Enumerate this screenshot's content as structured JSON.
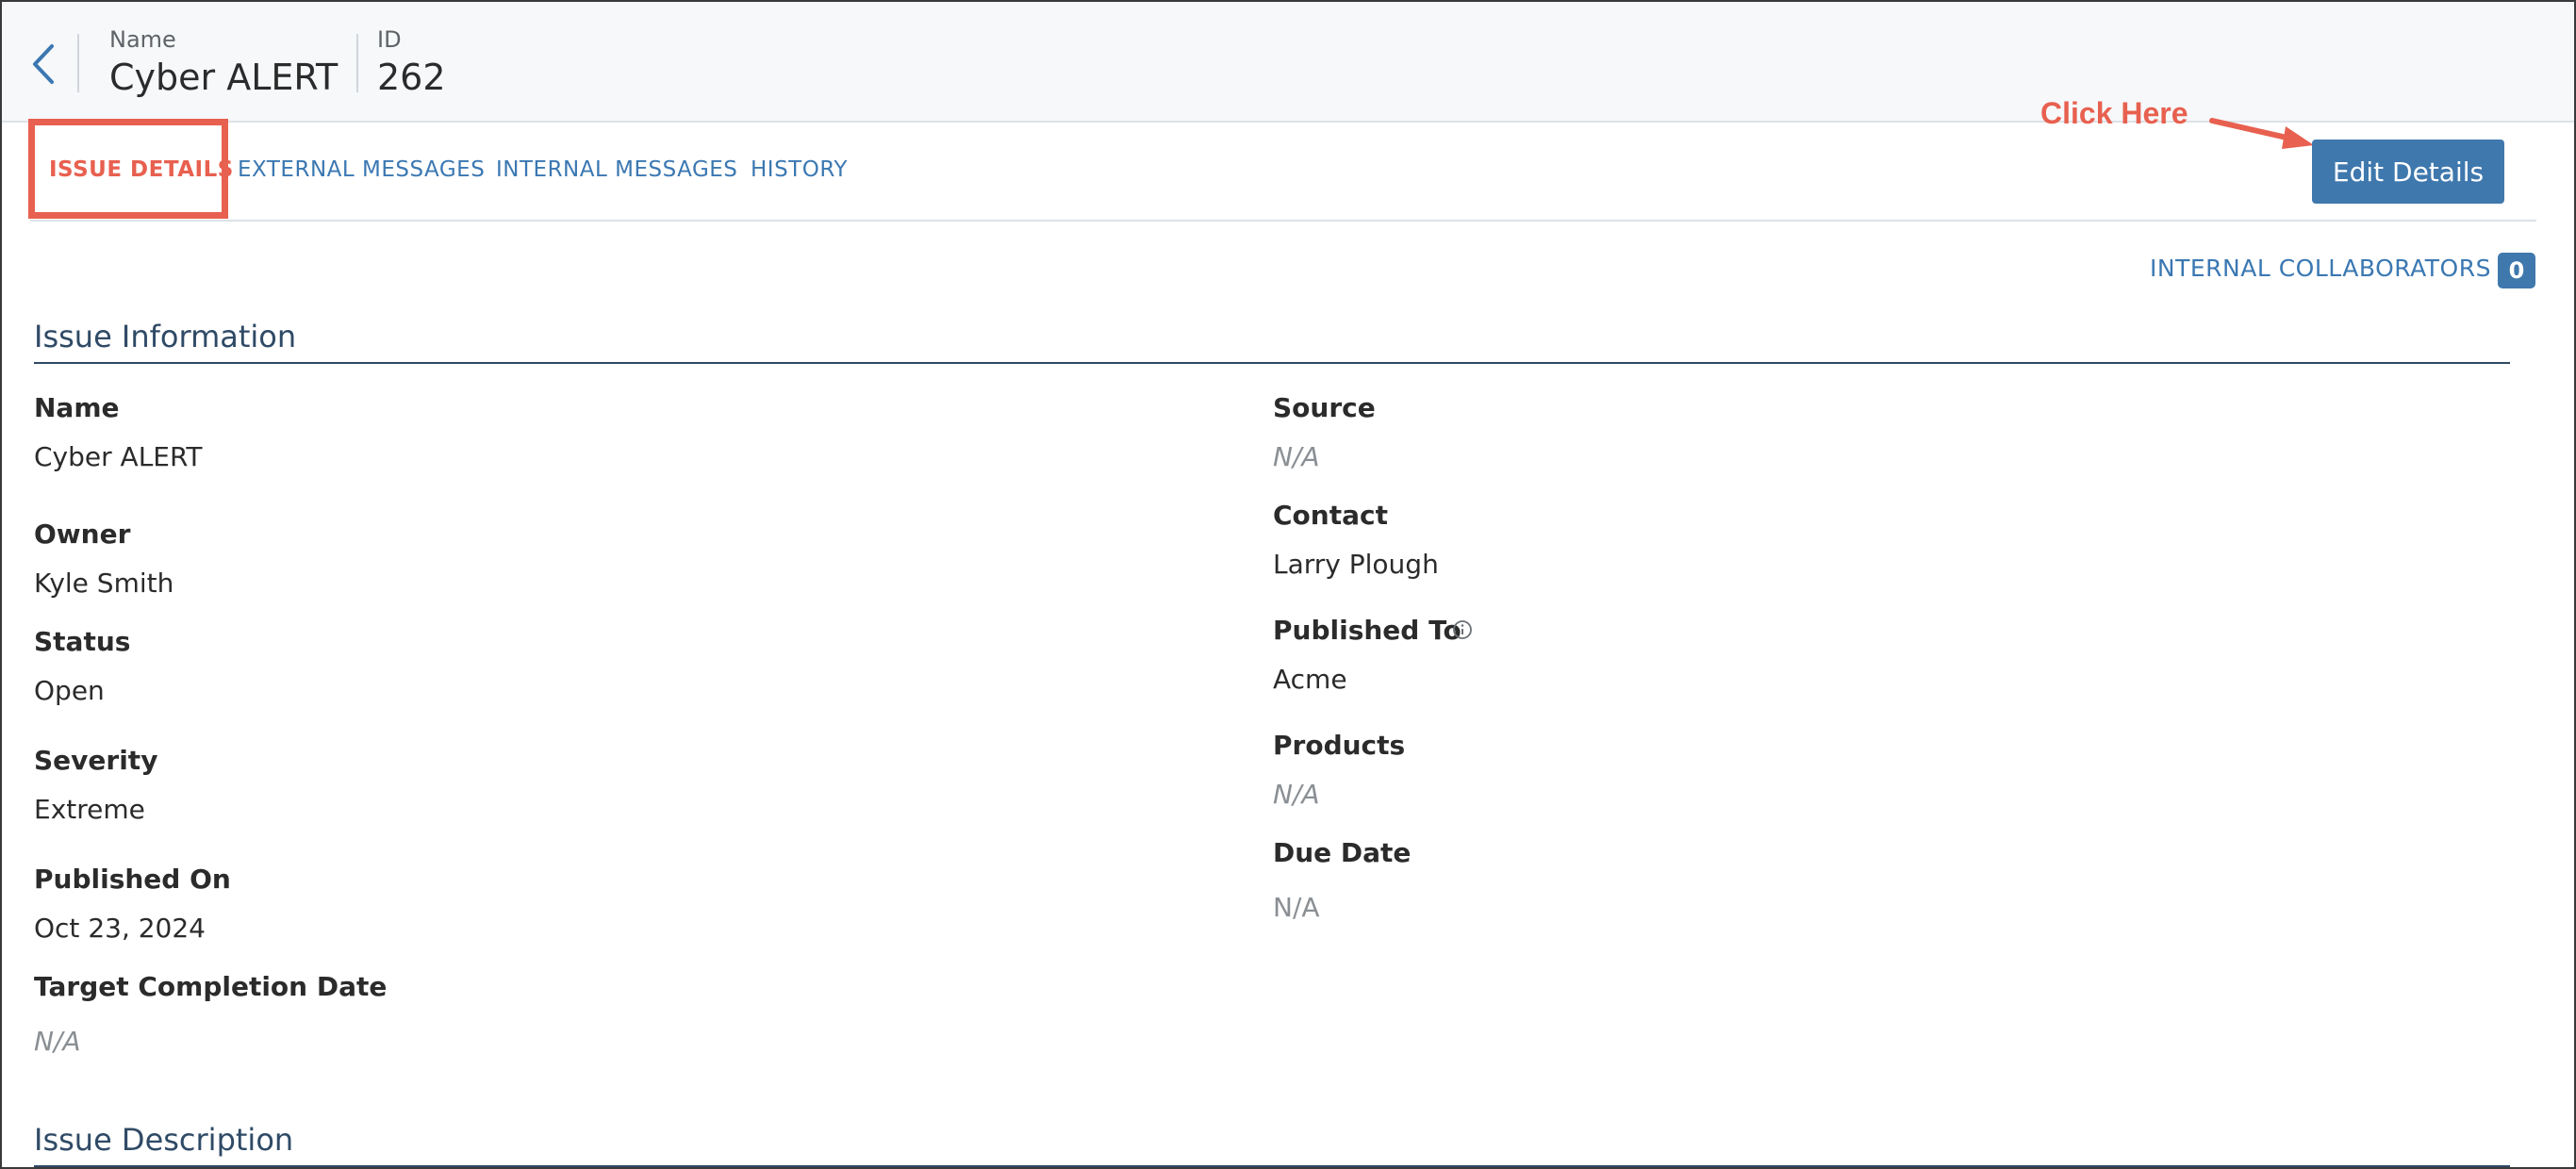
{
  "header": {
    "name_label": "Name",
    "name_value": "Cyber ALERT",
    "id_label": "ID",
    "id_value": "262"
  },
  "tabs": [
    {
      "label": "ISSUE DETAILS",
      "active": true
    },
    {
      "label": "EXTERNAL MESSAGES",
      "active": false
    },
    {
      "label": "INTERNAL MESSAGES",
      "active": false
    },
    {
      "label": "HISTORY",
      "active": false
    }
  ],
  "annotation": {
    "text": "Click Here"
  },
  "actions": {
    "edit_label": "Edit Details"
  },
  "collaborators": {
    "label": "INTERNAL COLLABORATORS",
    "count": "0"
  },
  "issue_information": {
    "title": "Issue Information",
    "left": [
      {
        "label": "Name",
        "value": "Cyber ALERT"
      },
      {
        "label": "Owner",
        "value": "Kyle Smith"
      },
      {
        "label": "Status",
        "value": "Open"
      },
      {
        "label": "Severity",
        "value": "Extreme"
      },
      {
        "label": "Published On",
        "value": "Oct 23, 2024"
      },
      {
        "label": "Target Completion Date",
        "value": "N/A"
      }
    ],
    "right": [
      {
        "label": "Source",
        "value": "N/A"
      },
      {
        "label": "Contact",
        "value": "Larry Plough"
      },
      {
        "label": "Published To",
        "value": "Acme"
      },
      {
        "label": "Products",
        "value": "N/A"
      },
      {
        "label": "Due Date",
        "value": "N/A"
      }
    ]
  },
  "issue_description": {
    "title": "Issue Description"
  },
  "icons": {
    "back": "chevron-left-icon",
    "info": "info-circle-icon"
  },
  "colors": {
    "accent": "#3f78ad",
    "link": "#3b78b2",
    "annotation": "#e8604f",
    "section": "#2f4a66"
  }
}
